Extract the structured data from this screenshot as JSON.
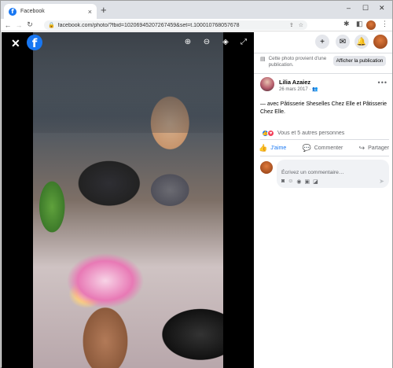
{
  "browser": {
    "tab_title": "Facebook",
    "favicon_letter": "f",
    "tab_close": "×",
    "new_tab": "+",
    "url": "facebook.com/photo/?fbid=10206945207267459&set=t.100010768057678",
    "controls": {
      "minimize": "–",
      "maximize": "☐",
      "close": "✕"
    }
  },
  "viewer": {
    "close_icon": "✕",
    "logo_letter": "f",
    "tools": [
      "zoom-in-icon",
      "zoom-out-icon",
      "tag-icon",
      "fullscreen-icon"
    ]
  },
  "pane": {
    "info_text": "Cette photo provient d'une publication.",
    "info_button": "Afficher la publication",
    "post": {
      "author": "Lilia Azaiez",
      "date": "26 mars 2017 · ",
      "audience_icon": "friends-icon",
      "caption": "— avec Pâtisserie Sheselles Chez Elle et Pâtisserie Chez Elle."
    },
    "reactions_text": "Vous et 5 autres personnes",
    "actions": {
      "like": "J'aime",
      "comment": "Commenter",
      "share": "Partager"
    },
    "comment_placeholder": "Écrivez un commentaire…"
  },
  "colors": {
    "facebook_blue": "#1877f2",
    "love_red": "#f33e58",
    "secondary_text": "#65676b",
    "viewer_bg": "#000000"
  }
}
